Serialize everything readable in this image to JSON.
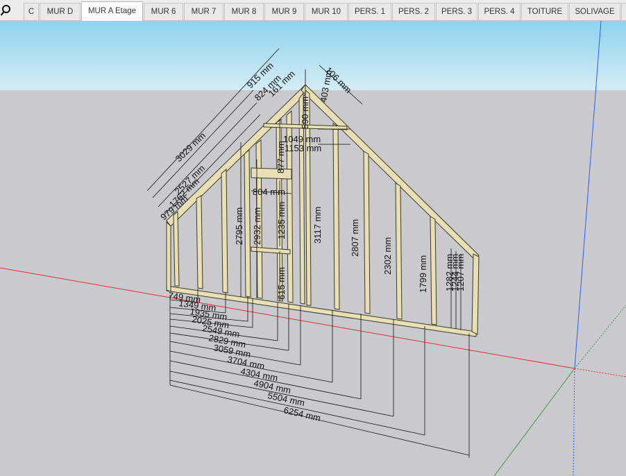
{
  "tabs": [
    {
      "label": "C",
      "active": false
    },
    {
      "label": "MUR D",
      "active": false
    },
    {
      "label": "MUR A Etage",
      "active": true
    },
    {
      "label": "MUR 6",
      "active": false
    },
    {
      "label": "MUR 7",
      "active": false
    },
    {
      "label": "MUR 8",
      "active": false
    },
    {
      "label": "MUR 9",
      "active": false
    },
    {
      "label": "MUR 10",
      "active": false
    },
    {
      "label": "PERS. 1",
      "active": false
    },
    {
      "label": "PERS. 2",
      "active": false
    },
    {
      "label": "PERS. 3",
      "active": false
    },
    {
      "label": "PERS. 4",
      "active": false
    },
    {
      "label": "TOITURE",
      "active": false
    },
    {
      "label": "SOLIVAGE",
      "active": false
    }
  ],
  "icons": {
    "search": "search-icon"
  },
  "colors": {
    "sky_top": "#8fd3ee",
    "ground": "#c9c9ce",
    "timber": "#e8dfb4",
    "red_axis": "#e03030",
    "blue_axis": "#2a5cff",
    "green_axis": "#3f9a3f"
  },
  "dimensions": {
    "base": [
      "749 mm",
      "1349 mm",
      "1935 mm",
      "2025 mm",
      "2549 mm",
      "2829 mm",
      "3059 mm",
      "3704 mm",
      "4304 mm",
      "4904 mm",
      "5504 mm",
      "6254 mm"
    ],
    "left_slope": [
      "979 mm",
      "1762 mm",
      "2527 mm",
      "3029 mm"
    ],
    "top": [
      "915 mm",
      "824 mm",
      "161 mm",
      "106 mm",
      "403 mm"
    ],
    "vertical": [
      "2795 mm",
      "2932 mm",
      "877 mm",
      "1235 mm",
      "3117 mm",
      "2807 mm",
      "2302 mm",
      "1799 mm",
      "1282 mm",
      "1244 mm",
      "1207 mm",
      "615 mm",
      "590 mm"
    ],
    "horizontal": [
      "1049 mm",
      "1153 mm",
      "804 mm"
    ]
  }
}
